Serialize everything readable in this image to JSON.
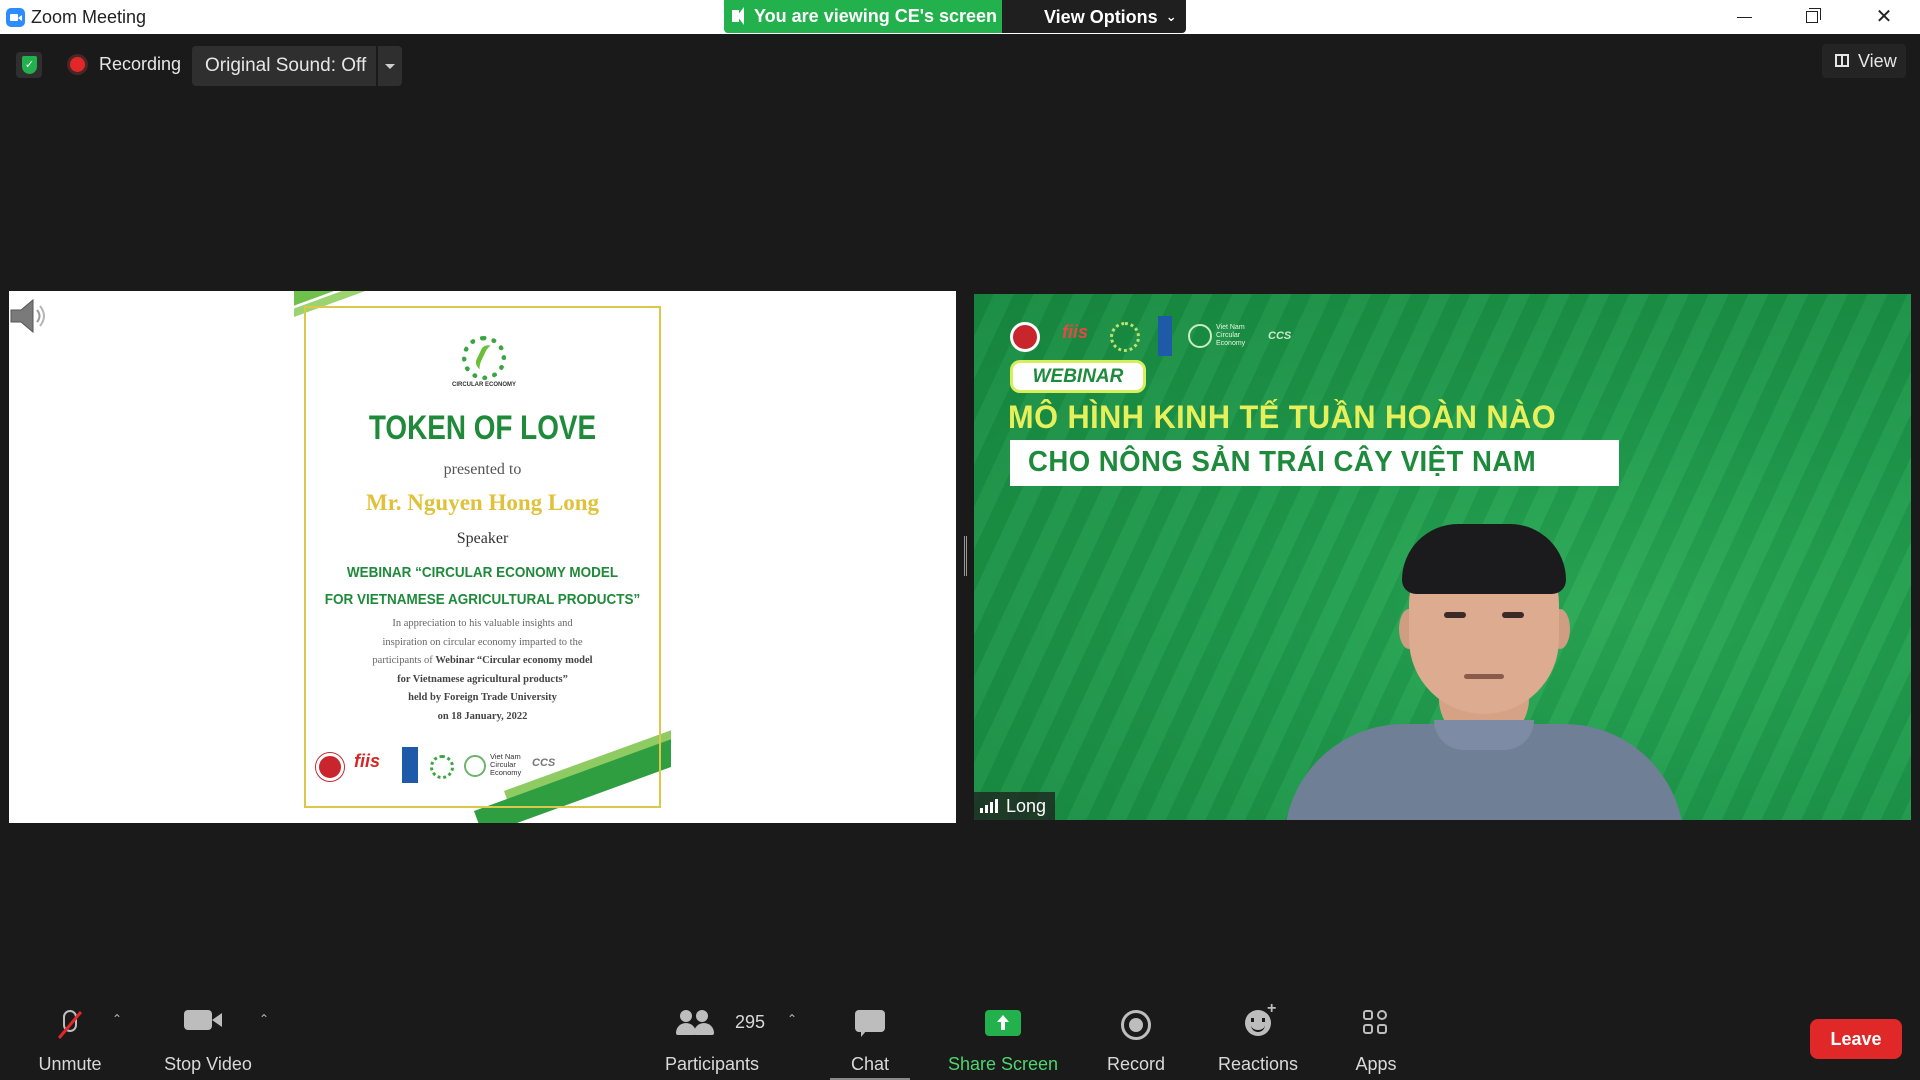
{
  "titlebar": {
    "app_title": "Zoom Meeting",
    "viewing_banner": "You are viewing CE's screen",
    "view_options": "View Options"
  },
  "topbar": {
    "recording_label": "Recording",
    "original_sound": "Original Sound: Off",
    "view_label": "View"
  },
  "certificate": {
    "logo_caption": "CIRCULAR ECONOMY",
    "title": "TOKEN OF LOVE",
    "presented_to": "presented to",
    "name": "Mr. Nguyen Hong Long",
    "role": "Speaker",
    "webinar_line1": "WEBINAR “CIRCULAR ECONOMY MODEL",
    "webinar_line2": "FOR VIETNAMESE AGRICULTURAL PRODUCTS”",
    "body_line1": "In appreciation to his valuable insights and",
    "body_line2": "inspiration on circular economy imparted to the",
    "body_line3a": "participants of ",
    "body_line3b": "Webinar “Circular economy model",
    "body_line4": "for Vietnamese agricultural products”",
    "body_line5": "held by Foreign Trade University",
    "body_line6": "on 18 January, 2022",
    "logo_fiis": "fiis",
    "logo_vnce": "Viet Nam Circular Economy",
    "logo_ccs": "CCS"
  },
  "video": {
    "webinar_pill": "WEBINAR",
    "headline1": "MÔ HÌNH KINH TẾ TUẦN HOÀN NÀO",
    "headline2": "CHO NÔNG SẢN TRÁI CÂY VIỆT NAM",
    "participant_name": "Long",
    "logo_fiis": "fiis",
    "logo_vnce": "Viet Nam Circular Economy",
    "logo_ccs": "CCS"
  },
  "toolbar": {
    "unmute": "Unmute",
    "stop_video": "Stop Video",
    "participants_count": "295",
    "participants": "Participants",
    "chat": "Chat",
    "share_screen": "Share Screen",
    "record": "Record",
    "reactions": "Reactions",
    "apps": "Apps",
    "leave": "Leave"
  },
  "colors": {
    "accent_green": "#23b14d",
    "leave_red": "#e02828",
    "certificate_green": "#1f8a3a",
    "certificate_gold": "#e0c13a"
  }
}
